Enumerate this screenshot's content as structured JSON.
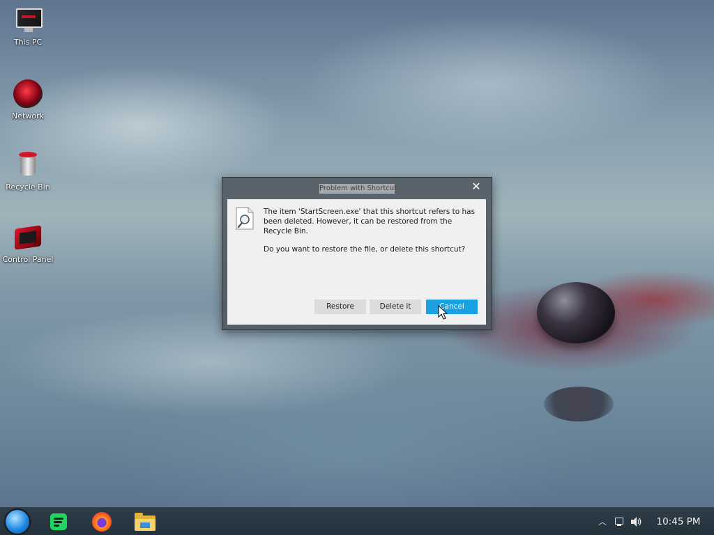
{
  "desktop": {
    "icons": [
      {
        "label": "This PC",
        "icon": "computer-icon"
      },
      {
        "label": "Network",
        "icon": "network-icon"
      },
      {
        "label": "Recycle Bin",
        "icon": "recycle-bin-icon"
      },
      {
        "label": "Control Panel",
        "icon": "control-panel-icon"
      }
    ]
  },
  "dialog": {
    "title": "Problem with Shortcut",
    "close_icon": "close-icon",
    "document_icon": "document-search-icon",
    "message_line": "The item 'StartScreen.exe' that this shortcut refers to has been deleted. However, it can be restored from the Recycle Bin.",
    "question": "Do you want to restore the file, or delete this shortcut?",
    "buttons": {
      "restore": "Restore",
      "delete": "Delete it",
      "cancel": "Cancel"
    },
    "accent_color": "#1ba1e2"
  },
  "taskbar": {
    "start_icon": "start-orb-icon",
    "apps": [
      {
        "icon": "spotify-icon"
      },
      {
        "icon": "firefox-icon"
      },
      {
        "icon": "file-explorer-icon"
      }
    ],
    "tray": {
      "chevron_icon": "chevron-up-icon",
      "network_icon": "network-status-icon",
      "volume_icon": "volume-icon",
      "clock": "10:45 PM"
    }
  }
}
